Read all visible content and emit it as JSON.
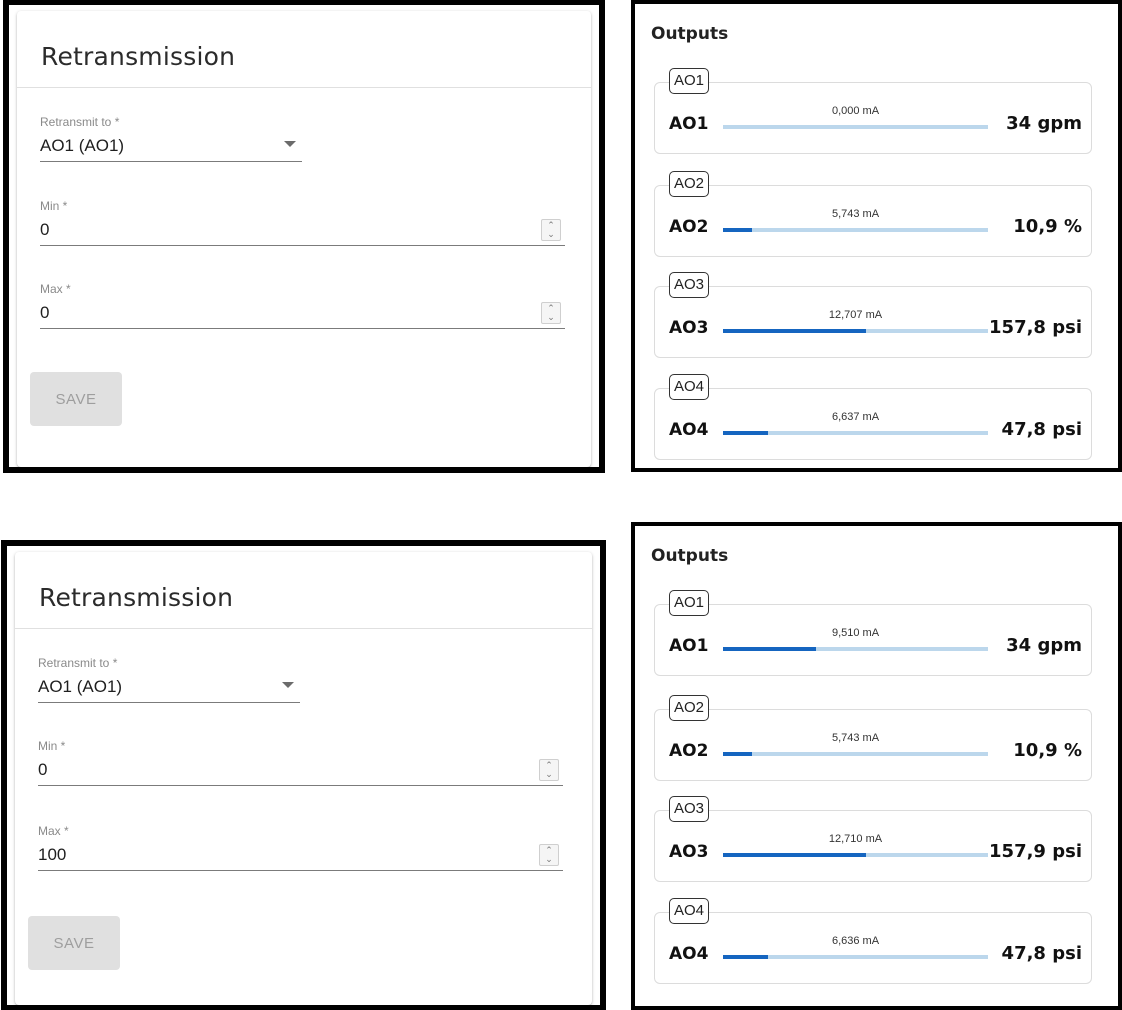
{
  "panels": [
    {
      "retransmission": {
        "title": "Retransmission",
        "retransmit_to_label": "Retransmit to *",
        "retransmit_to_value": "AO1 (AO1)",
        "min_label": "Min *",
        "min_value": "0",
        "max_label": "Max *",
        "max_value": "0",
        "save_label": "SAVE"
      },
      "outputs": {
        "title": "Outputs",
        "items": [
          {
            "tag": "AO1",
            "name": "AO1",
            "ma": "0,000 mA",
            "value": "34 gpm",
            "fill": 0.0
          },
          {
            "tag": "AO2",
            "name": "AO2",
            "ma": "5,743 mA",
            "value": "10,9 %",
            "fill": 0.11
          },
          {
            "tag": "AO3",
            "name": "AO3",
            "ma": "12,707 mA",
            "value": "157,8 psi",
            "fill": 0.54
          },
          {
            "tag": "AO4",
            "name": "AO4",
            "ma": "6,637 mA",
            "value": "47,8 psi",
            "fill": 0.17
          }
        ]
      }
    },
    {
      "retransmission": {
        "title": "Retransmission",
        "retransmit_to_label": "Retransmit to *",
        "retransmit_to_value": "AO1 (AO1)",
        "min_label": "Min *",
        "min_value": "0",
        "max_label": "Max *",
        "max_value": "100",
        "save_label": "SAVE"
      },
      "outputs": {
        "title": "Outputs",
        "items": [
          {
            "tag": "AO1",
            "name": "AO1",
            "ma": "9,510 mA",
            "value": "34 gpm",
            "fill": 0.35
          },
          {
            "tag": "AO2",
            "name": "AO2",
            "ma": "5,743 mA",
            "value": "10,9 %",
            "fill": 0.11
          },
          {
            "tag": "AO3",
            "name": "AO3",
            "ma": "12,710 mA",
            "value": "157,9 psi",
            "fill": 0.54
          },
          {
            "tag": "AO4",
            "name": "AO4",
            "ma": "6,636 mA",
            "value": "47,8 psi",
            "fill": 0.17
          }
        ]
      }
    }
  ],
  "colors": {
    "bar_fill": "#1565c0",
    "bar_track": "#bcd7ec",
    "button_disabled_bg": "#e0e0e0",
    "button_disabled_text": "#9e9e9e"
  },
  "icons": {
    "select": "chevron-down-icon",
    "spinner": "spinner-arrows-icon"
  }
}
